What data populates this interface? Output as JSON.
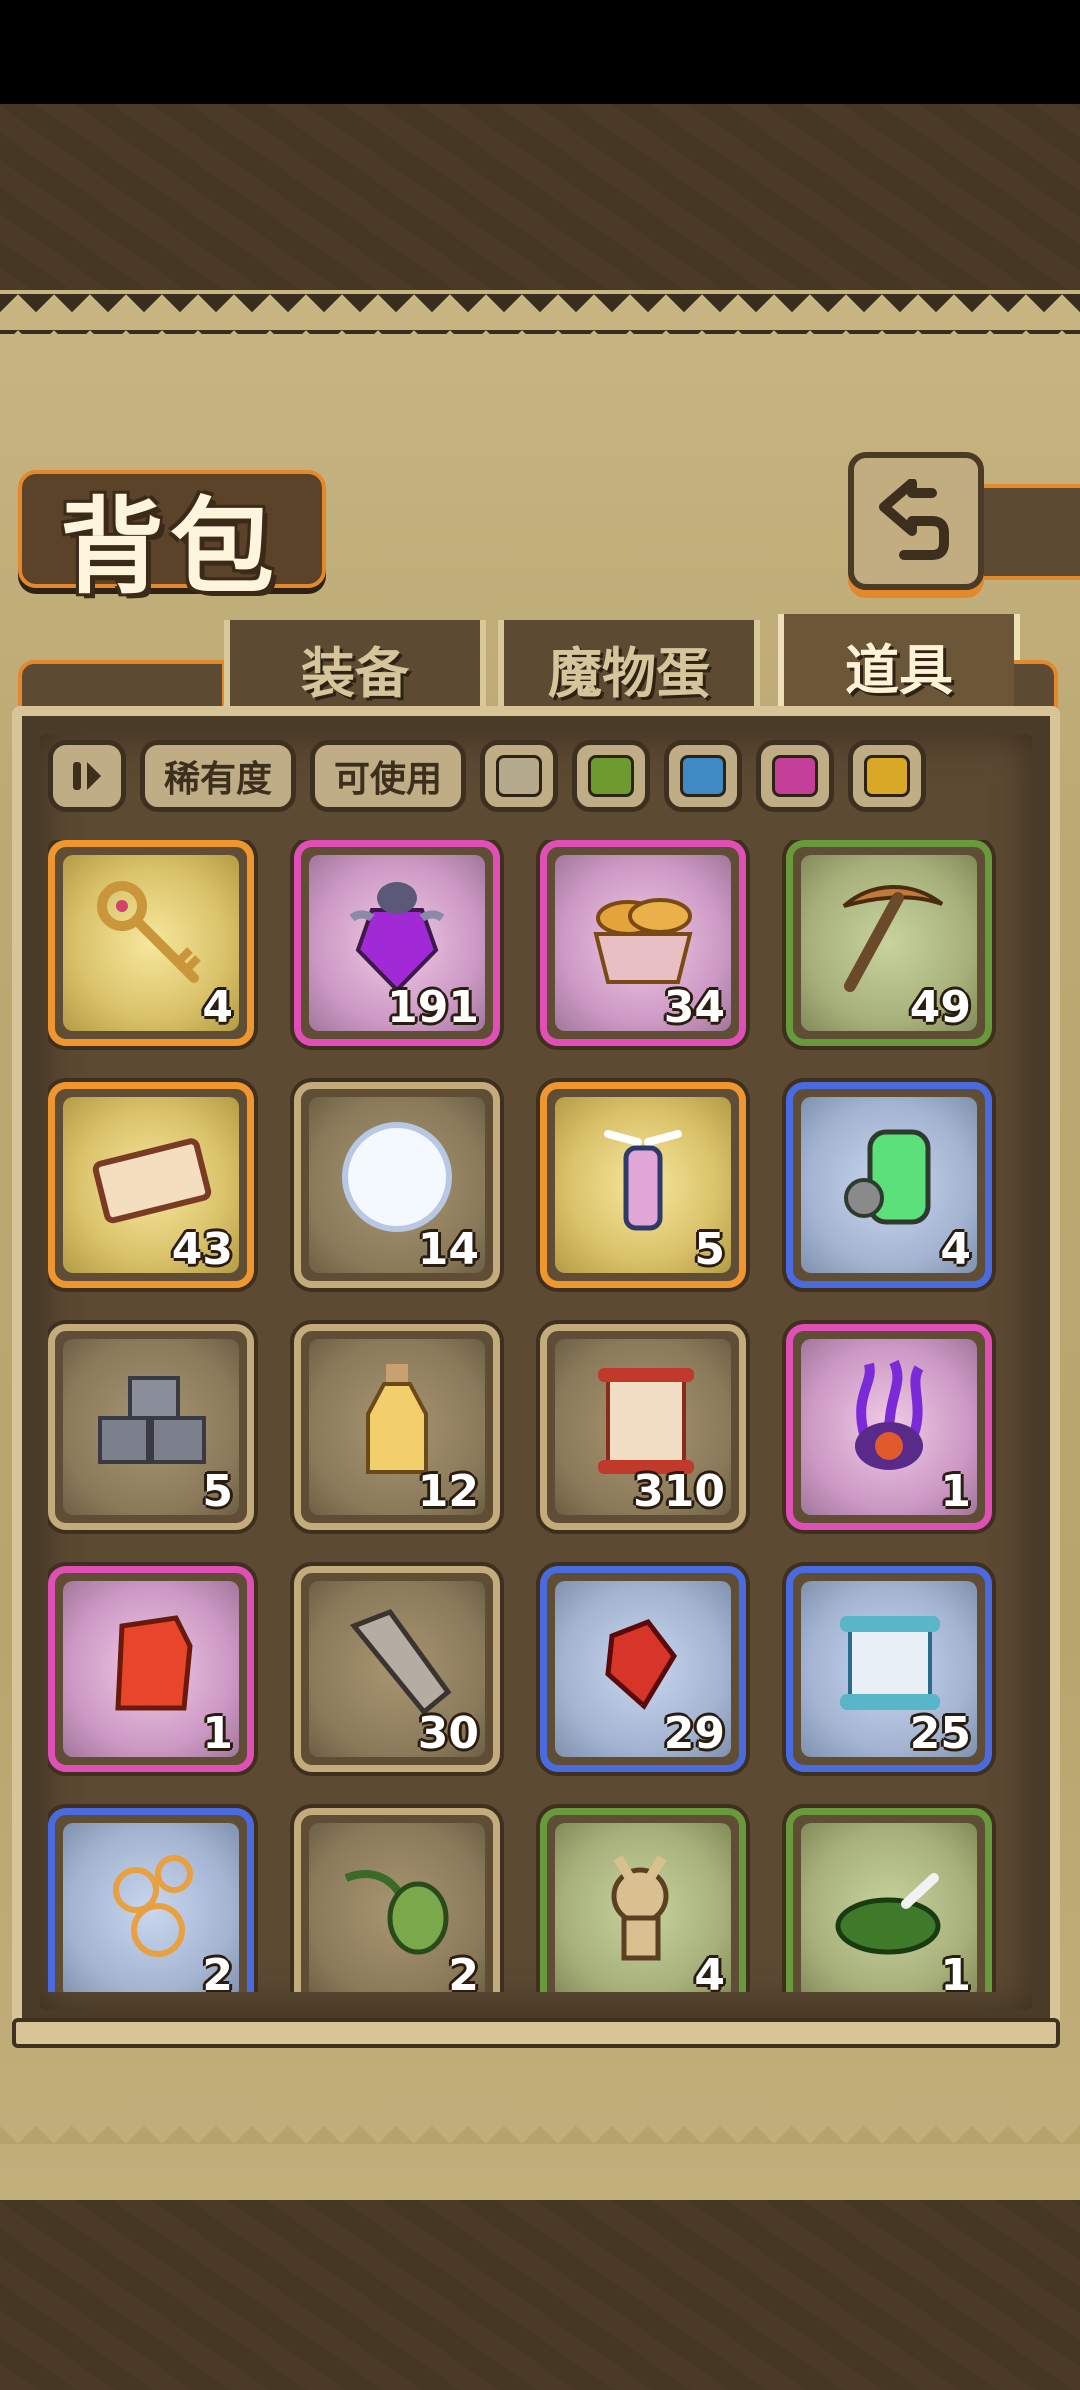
{
  "header": {
    "title": "背包"
  },
  "tabs": [
    {
      "label": "装备",
      "active": false
    },
    {
      "label": "魔物蛋",
      "active": false
    },
    {
      "label": "道具",
      "active": true
    }
  ],
  "filters": {
    "rarity_label": "稀有度",
    "usable_label": "可使用",
    "color_swatches": [
      "#b4a98a",
      "#6f9a2f",
      "#3f8ac4",
      "#c43f98",
      "#d9a827"
    ]
  },
  "colors": {
    "orange": "#f0962e",
    "purple": "#e04fb5",
    "blue": "#4a6be0",
    "green": "#68993a",
    "common": "#c2ac7c"
  },
  "items": [
    {
      "icon": "golden-key-icon",
      "count": "4",
      "rarity": "orange"
    },
    {
      "icon": "purple-potion-flask-icon",
      "count": "191",
      "rarity": "purple"
    },
    {
      "icon": "bread-basket-icon",
      "count": "34",
      "rarity": "purple"
    },
    {
      "icon": "pickaxe-icon",
      "count": "49",
      "rarity": "green"
    },
    {
      "icon": "ticket-icon",
      "count": "43",
      "rarity": "orange"
    },
    {
      "icon": "snowball-icon",
      "count": "14",
      "rarity": "gray"
    },
    {
      "icon": "winged-lantern-icon",
      "count": "5",
      "rarity": "orange"
    },
    {
      "icon": "green-canister-icon",
      "count": "4",
      "rarity": "blue"
    },
    {
      "icon": "stone-blocks-icon",
      "count": "5",
      "rarity": "gray"
    },
    {
      "icon": "oil-bottle-icon",
      "count": "12",
      "rarity": "gray"
    },
    {
      "icon": "red-scroll-icon",
      "count": "310",
      "rarity": "gray"
    },
    {
      "icon": "tentacle-eye-icon",
      "count": "1",
      "rarity": "purple"
    },
    {
      "icon": "fire-crystal-icon",
      "count": "1",
      "rarity": "purple"
    },
    {
      "icon": "stone-slab-icon",
      "count": "30",
      "rarity": "gray"
    },
    {
      "icon": "ruby-shard-icon",
      "count": "29",
      "rarity": "blue"
    },
    {
      "icon": "blue-scroll-icon",
      "count": "25",
      "rarity": "blue"
    },
    {
      "icon": "glowing-orbs-icon",
      "count": "2",
      "rarity": "blue"
    },
    {
      "icon": "green-seed-icon",
      "count": "2",
      "rarity": "gray"
    },
    {
      "icon": "straw-doll-icon",
      "count": "4",
      "rarity": "green"
    },
    {
      "icon": "moss-bone-icon",
      "count": "1",
      "rarity": "green"
    }
  ]
}
